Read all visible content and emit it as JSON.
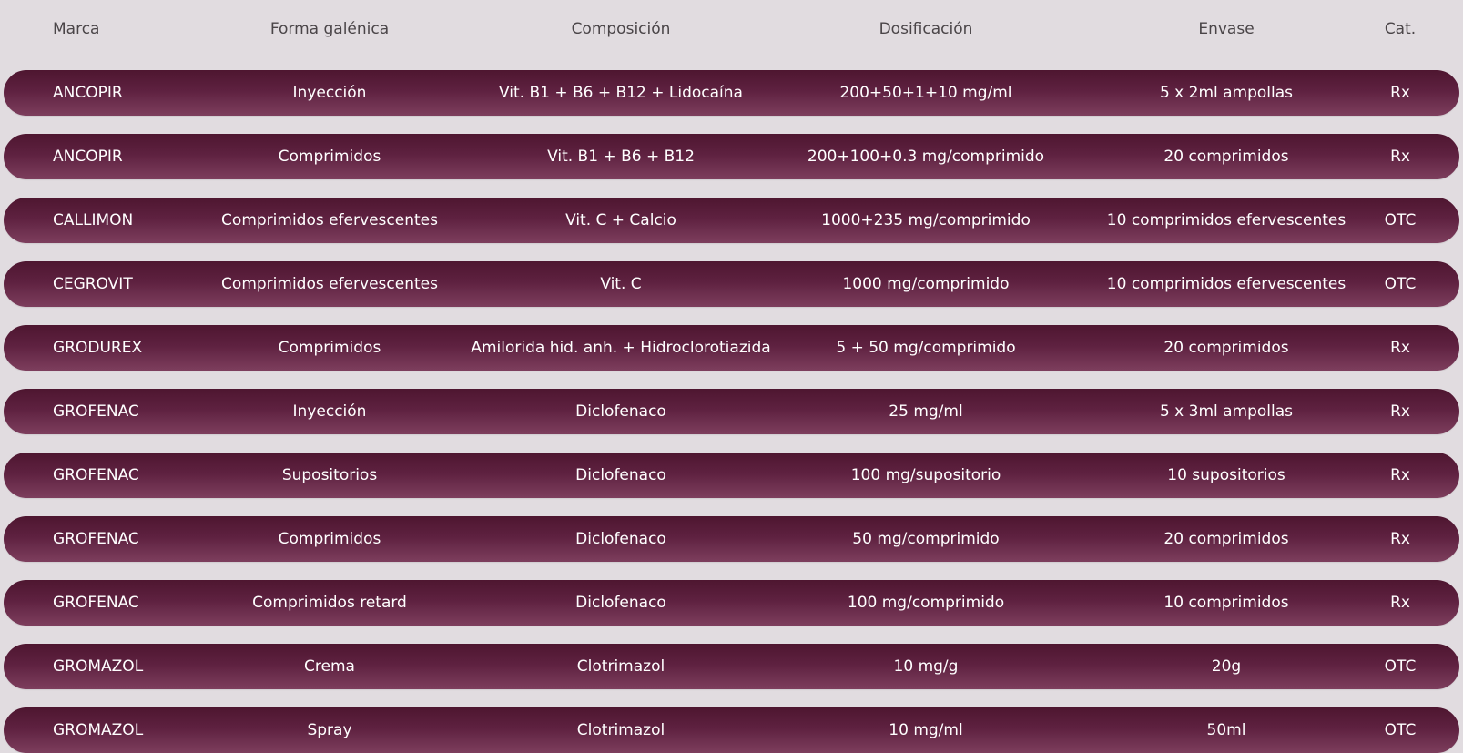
{
  "header": {
    "marca": "Marca",
    "forma": "Forma galénica",
    "composicion": "Composición",
    "dosificacion": "Dosificación",
    "envase": "Envase",
    "cat": "Cat."
  },
  "rows": [
    {
      "marca": "ANCOPIR",
      "forma": "Inyección",
      "composicion": "Vit. B1 + B6 + B12 + Lidocaína",
      "dosificacion": "200+50+1+10 mg/ml",
      "envase": "5 x 2ml ampollas",
      "cat": "Rx"
    },
    {
      "marca": "ANCOPIR",
      "forma": "Comprimidos",
      "composicion": "Vit. B1 + B6 + B12",
      "dosificacion": "200+100+0.3 mg/comprimido",
      "envase": "20 comprimidos",
      "cat": "Rx"
    },
    {
      "marca": "CALLIMON",
      "forma": "Comprimidos efervescentes",
      "composicion": "Vit. C + Calcio",
      "dosificacion": "1000+235 mg/comprimido",
      "envase": "10 comprimidos efervescentes",
      "cat": "OTC"
    },
    {
      "marca": "CEGROVIT",
      "forma": "Comprimidos efervescentes",
      "composicion": "Vit. C",
      "dosificacion": "1000 mg/comprimido",
      "envase": "10 comprimidos efervescentes",
      "cat": "OTC"
    },
    {
      "marca": "GRODUREX",
      "forma": "Comprimidos",
      "composicion": "Amilorida hid. anh. + Hidroclorotiazida",
      "dosificacion": "5 + 50 mg/comprimido",
      "envase": "20 comprimidos",
      "cat": "Rx"
    },
    {
      "marca": "GROFENAC",
      "forma": "Inyección",
      "composicion": "Diclofenaco",
      "dosificacion": "25 mg/ml",
      "envase": "5 x 3ml ampollas",
      "cat": "Rx"
    },
    {
      "marca": "GROFENAC",
      "forma": "Supositorios",
      "composicion": "Diclofenaco",
      "dosificacion": "100 mg/supositorio",
      "envase": "10 supositorios",
      "cat": "Rx"
    },
    {
      "marca": "GROFENAC",
      "forma": "Comprimidos",
      "composicion": "Diclofenaco",
      "dosificacion": "50 mg/comprimido",
      "envase": "20 comprimidos",
      "cat": "Rx"
    },
    {
      "marca": "GROFENAC",
      "forma": "Comprimidos retard",
      "composicion": "Diclofenaco",
      "dosificacion": "100 mg/comprimido",
      "envase": "10 comprimidos",
      "cat": "Rx"
    },
    {
      "marca": "GROMAZOL",
      "forma": "Crema",
      "composicion": "Clotrimazol",
      "dosificacion": "10 mg/g",
      "envase": "20g",
      "cat": "OTC"
    },
    {
      "marca": "GROMAZOL",
      "forma": "Spray",
      "composicion": "Clotrimazol",
      "dosificacion": "10 mg/ml",
      "envase": "50ml",
      "cat": "OTC"
    }
  ]
}
